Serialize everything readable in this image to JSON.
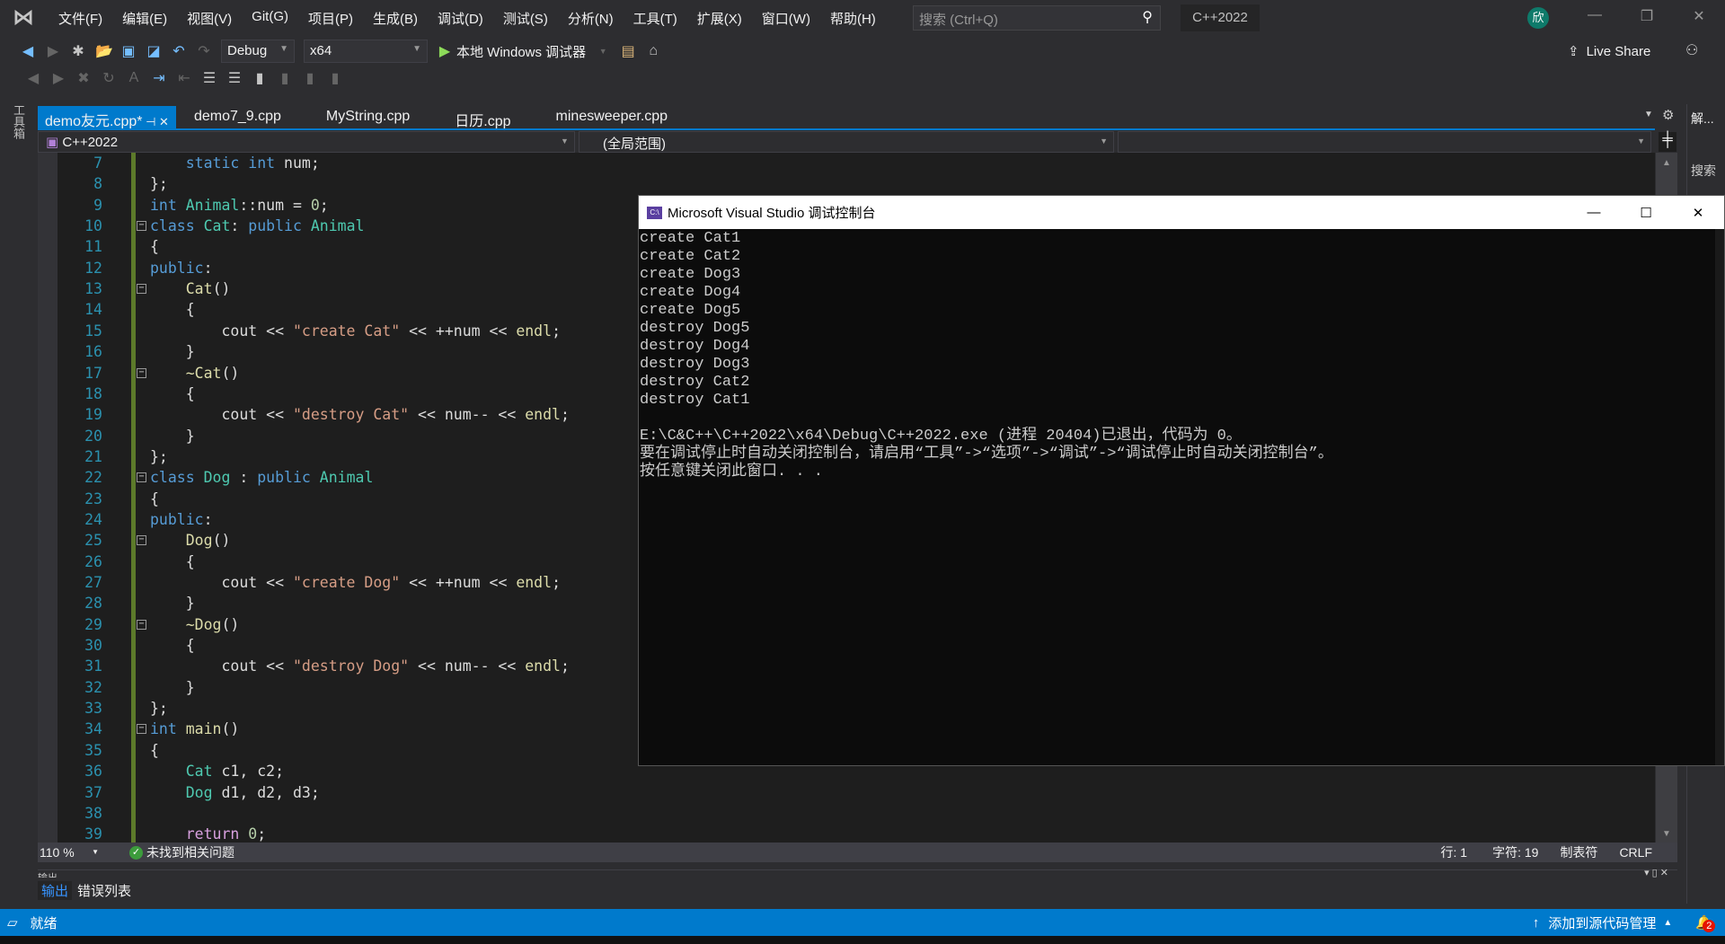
{
  "menu": [
    "文件(F)",
    "编辑(E)",
    "视图(V)",
    "Git(G)",
    "项目(P)",
    "生成(B)",
    "调试(D)",
    "测试(S)",
    "分析(N)",
    "工具(T)",
    "扩展(X)",
    "窗口(W)",
    "帮助(H)"
  ],
  "search_placeholder": "搜索 (Ctrl+Q)",
  "solution_name": "C++2022",
  "avatar_initial": "欣",
  "toolbar": {
    "config": "Debug",
    "platform": "x64",
    "run_label": "本地 Windows 调试器",
    "live_share": "Live Share"
  },
  "toolbox_label": "工具箱",
  "tabs": [
    {
      "label": "demo友元.cpp*",
      "active": true
    },
    {
      "label": "demo7_9.cpp"
    },
    {
      "label": "MyString.cpp"
    },
    {
      "label": "日历.cpp"
    },
    {
      "label": "minesweeper.cpp"
    }
  ],
  "navbar": {
    "project": "C++2022",
    "scope": "(全局范围)",
    "member": ""
  },
  "right_panel": {
    "solution": "解...",
    "search": "搜索"
  },
  "code": {
    "lines": [
      {
        "n": 7,
        "tk": [
          [
            "pl",
            "    "
          ],
          [
            "kw",
            "static"
          ],
          [
            "pl",
            " "
          ],
          [
            "kw",
            "int"
          ],
          [
            "pl",
            " num;"
          ]
        ]
      },
      {
        "n": 8,
        "tk": [
          [
            "pl",
            "};"
          ]
        ]
      },
      {
        "n": 9,
        "tk": [
          [
            "kw",
            "int"
          ],
          [
            "pl",
            " "
          ],
          [
            "ty",
            "Animal"
          ],
          [
            "pl",
            "::num = "
          ],
          [
            "nu",
            "0"
          ],
          [
            "pl",
            ";"
          ]
        ]
      },
      {
        "n": 10,
        "fold": true,
        "tk": [
          [
            "kw",
            "class"
          ],
          [
            "pl",
            " "
          ],
          [
            "ty",
            "Cat"
          ],
          [
            "pl",
            ": "
          ],
          [
            "kw",
            "public"
          ],
          [
            "pl",
            " "
          ],
          [
            "ty",
            "Animal"
          ]
        ]
      },
      {
        "n": 11,
        "tk": [
          [
            "pl",
            "{"
          ]
        ]
      },
      {
        "n": 12,
        "tk": [
          [
            "kw",
            "public"
          ],
          [
            "pl",
            ":"
          ]
        ]
      },
      {
        "n": 13,
        "fold": true,
        "tk": [
          [
            "pl",
            "    "
          ],
          [
            "fn",
            "Cat"
          ],
          [
            "pl",
            "()"
          ]
        ]
      },
      {
        "n": 14,
        "tk": [
          [
            "pl",
            "    {"
          ]
        ]
      },
      {
        "n": 15,
        "tk": [
          [
            "pl",
            "        cout << "
          ],
          [
            "st",
            "\"create Cat\""
          ],
          [
            "pl",
            " << ++num << "
          ],
          [
            "fn",
            "endl"
          ],
          [
            "pl",
            ";"
          ]
        ]
      },
      {
        "n": 16,
        "tk": [
          [
            "pl",
            "    }"
          ]
        ]
      },
      {
        "n": 17,
        "fold": true,
        "tk": [
          [
            "pl",
            "    "
          ],
          [
            "fn",
            "~Cat"
          ],
          [
            "pl",
            "()"
          ]
        ]
      },
      {
        "n": 18,
        "tk": [
          [
            "pl",
            "    {"
          ]
        ]
      },
      {
        "n": 19,
        "tk": [
          [
            "pl",
            "        cout << "
          ],
          [
            "st",
            "\"destroy Cat\""
          ],
          [
            "pl",
            " << num-- << "
          ],
          [
            "fn",
            "endl"
          ],
          [
            "pl",
            ";"
          ]
        ]
      },
      {
        "n": 20,
        "tk": [
          [
            "pl",
            "    }"
          ]
        ]
      },
      {
        "n": 21,
        "tk": [
          [
            "pl",
            "};"
          ]
        ]
      },
      {
        "n": 22,
        "fold": true,
        "tk": [
          [
            "kw",
            "class"
          ],
          [
            "pl",
            " "
          ],
          [
            "ty",
            "Dog"
          ],
          [
            "pl",
            " : "
          ],
          [
            "kw",
            "public"
          ],
          [
            "pl",
            " "
          ],
          [
            "ty",
            "Animal"
          ]
        ]
      },
      {
        "n": 23,
        "tk": [
          [
            "pl",
            "{"
          ]
        ]
      },
      {
        "n": 24,
        "tk": [
          [
            "kw",
            "public"
          ],
          [
            "pl",
            ":"
          ]
        ]
      },
      {
        "n": 25,
        "fold": true,
        "tk": [
          [
            "pl",
            "    "
          ],
          [
            "fn",
            "Dog"
          ],
          [
            "pl",
            "()"
          ]
        ]
      },
      {
        "n": 26,
        "tk": [
          [
            "pl",
            "    {"
          ]
        ]
      },
      {
        "n": 27,
        "tk": [
          [
            "pl",
            "        cout << "
          ],
          [
            "st",
            "\"create Dog\""
          ],
          [
            "pl",
            " << ++num << "
          ],
          [
            "fn",
            "endl"
          ],
          [
            "pl",
            ";"
          ]
        ]
      },
      {
        "n": 28,
        "tk": [
          [
            "pl",
            "    }"
          ]
        ]
      },
      {
        "n": 29,
        "fold": true,
        "tk": [
          [
            "pl",
            "    "
          ],
          [
            "fn",
            "~Dog"
          ],
          [
            "pl",
            "()"
          ]
        ]
      },
      {
        "n": 30,
        "tk": [
          [
            "pl",
            "    {"
          ]
        ]
      },
      {
        "n": 31,
        "tk": [
          [
            "pl",
            "        cout << "
          ],
          [
            "st",
            "\"destroy Dog\""
          ],
          [
            "pl",
            " << num-- << "
          ],
          [
            "fn",
            "endl"
          ],
          [
            "pl",
            ";"
          ]
        ]
      },
      {
        "n": 32,
        "tk": [
          [
            "pl",
            "    }"
          ]
        ]
      },
      {
        "n": 33,
        "tk": [
          [
            "pl",
            "};"
          ]
        ]
      },
      {
        "n": 34,
        "fold": true,
        "tk": [
          [
            "kw",
            "int"
          ],
          [
            "pl",
            " "
          ],
          [
            "fn",
            "main"
          ],
          [
            "pl",
            "()"
          ]
        ]
      },
      {
        "n": 35,
        "tk": [
          [
            "pl",
            "{"
          ]
        ]
      },
      {
        "n": 36,
        "tk": [
          [
            "pl",
            "    "
          ],
          [
            "ty",
            "Cat"
          ],
          [
            "pl",
            " c1, c2;"
          ]
        ]
      },
      {
        "n": 37,
        "tk": [
          [
            "pl",
            "    "
          ],
          [
            "ty",
            "Dog"
          ],
          [
            "pl",
            " d1, d2, d3;"
          ]
        ]
      },
      {
        "n": 38,
        "tk": []
      },
      {
        "n": 39,
        "tk": [
          [
            "pl",
            "    "
          ],
          [
            "ct",
            "return"
          ],
          [
            "pl",
            " "
          ],
          [
            "nu",
            "0"
          ],
          [
            "pl",
            ";"
          ]
        ]
      }
    ]
  },
  "editor_status": {
    "zoom": "110 %",
    "issues": "未找到相关问题",
    "line": "行: 1",
    "char": "字符: 19",
    "indent": "制表符",
    "eol": "CRLF"
  },
  "output_panel": {
    "title": "输出",
    "tabs": [
      "输出",
      "错误列表"
    ]
  },
  "statusbar": {
    "ready": "就绪",
    "source_control": "添加到源代码管理",
    "notifications": "2"
  },
  "console": {
    "title": "Microsoft Visual Studio 调试控制台",
    "lines": [
      "create Cat1",
      "create Cat2",
      "create Dog3",
      "create Dog4",
      "create Dog5",
      "destroy Dog5",
      "destroy Dog4",
      "destroy Dog3",
      "destroy Cat2",
      "destroy Cat1",
      "",
      "E:\\C&C++\\C++2022\\x64\\Debug\\C++2022.exe (进程 20404)已退出，代码为 0。",
      "要在调试停止时自动关闭控制台，请启用“工具”->“选项”->“调试”->“调试停止时自动关闭控制台”。",
      "按任意键关闭此窗口. . ."
    ]
  },
  "colors": {
    "accent": "#007acc",
    "keyword": "#569cd6",
    "type": "#4ec9b0",
    "string": "#d69d85",
    "function": "#dcdcaa",
    "line_number": "#2b91af"
  }
}
